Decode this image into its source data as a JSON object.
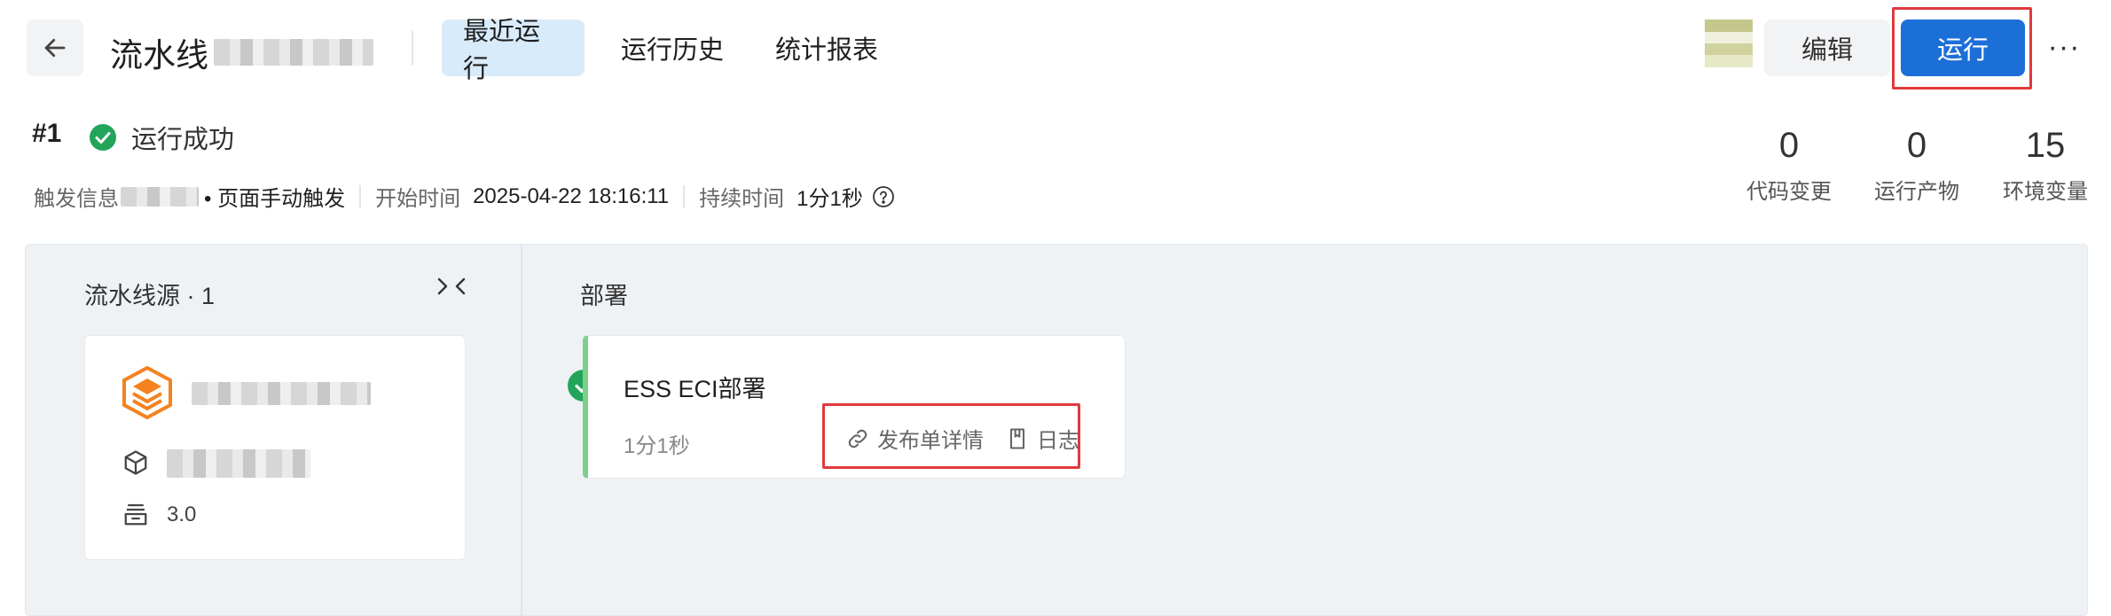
{
  "header": {
    "back_icon": "arrow-left-icon",
    "title": "流水线",
    "tabs": [
      {
        "label": "最近运行",
        "active": true
      },
      {
        "label": "运行历史",
        "active": false
      },
      {
        "label": "统计报表",
        "active": false
      }
    ],
    "edit_label": "编辑",
    "run_label": "运行",
    "more_label": "···"
  },
  "run": {
    "number": "#1",
    "status": "运行成功",
    "trigger_label": "触发信息",
    "trigger_value": "• 页面手动触发",
    "start_label": "开始时间",
    "start_value": "2025-04-22 18:16:11",
    "duration_label": "持续时间",
    "duration_value": "1分1秒"
  },
  "stats": [
    {
      "value": "0",
      "label": "代码变更"
    },
    {
      "value": "0",
      "label": "运行产物"
    },
    {
      "value": "15",
      "label": "环境变量"
    }
  ],
  "source": {
    "title": "流水线源 · 1",
    "version": "3.0"
  },
  "stage": {
    "title": "部署",
    "job": {
      "name": "ESS ECI部署",
      "duration": "1分1秒",
      "actions": [
        "发布单详情",
        "日志"
      ]
    }
  },
  "colors": {
    "primary": "#1d6fd8",
    "active_tab_bg": "#d8ebfb",
    "success": "#22a55a",
    "highlight_outline": "#e0393e",
    "job_status_bar": "#7cd08c"
  }
}
